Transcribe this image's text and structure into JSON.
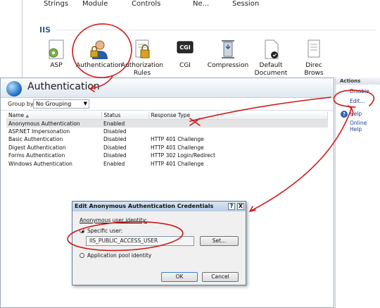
{
  "top_labels": [
    "Strings",
    "Controls",
    "Module",
    "Ne...",
    "Session"
  ],
  "section": {
    "title": "IIS"
  },
  "features": [
    {
      "label": "ASP",
      "icon": "asp-icon"
    },
    {
      "label": "Authentication",
      "icon": "authentication-icon"
    },
    {
      "label": "Authorization\nRules",
      "icon": "authorization-rules-icon"
    },
    {
      "label": "CGI",
      "icon": "cgi-icon"
    },
    {
      "label": "Compression",
      "icon": "compression-icon"
    },
    {
      "label": "Default\nDocument",
      "icon": "default-document-icon"
    },
    {
      "label": "Direc\nBrows",
      "icon": "directory-browsing-icon"
    }
  ],
  "auth": {
    "title": "Authentication",
    "group_by_label": "Group by:",
    "group_by_value": "No Grouping",
    "columns": [
      "Name",
      "Status",
      "Response Type"
    ],
    "rows": [
      {
        "name": "Anonymous Authentication",
        "status": "Enabled",
        "response": ""
      },
      {
        "name": "ASP.NET Impersonation",
        "status": "Disabled",
        "response": ""
      },
      {
        "name": "Basic Authentication",
        "status": "Disabled",
        "response": "HTTP 401 Challenge"
      },
      {
        "name": "Digest Authentication",
        "status": "Disabled",
        "response": "HTTP 401 Challenge"
      },
      {
        "name": "Forms Authentication",
        "status": "Disabled",
        "response": "HTTP 302 Login/Redirect"
      },
      {
        "name": "Windows Authentication",
        "status": "Enabled",
        "response": "HTTP 401 Challenge"
      }
    ]
  },
  "actions": {
    "header": "Actions",
    "disable": "Disable",
    "edit": "Edit...",
    "help": "Help",
    "online_help": "Online Help"
  },
  "dialog": {
    "title": "Edit Anonymous Authentication Credentials",
    "help_btn": "?",
    "close_btn": "X",
    "identity_label": "Anonymous user identity:",
    "specific_user_label": "Specific user:",
    "user_value": "IIS_PUBLIC_ACCESS_USER",
    "set_button": "Set...",
    "app_pool_label": "Application pool identity",
    "ok": "OK",
    "cancel": "Cancel"
  },
  "colors": {
    "annotation": "#d01a1a",
    "header_blue": "#2f5f8f"
  }
}
